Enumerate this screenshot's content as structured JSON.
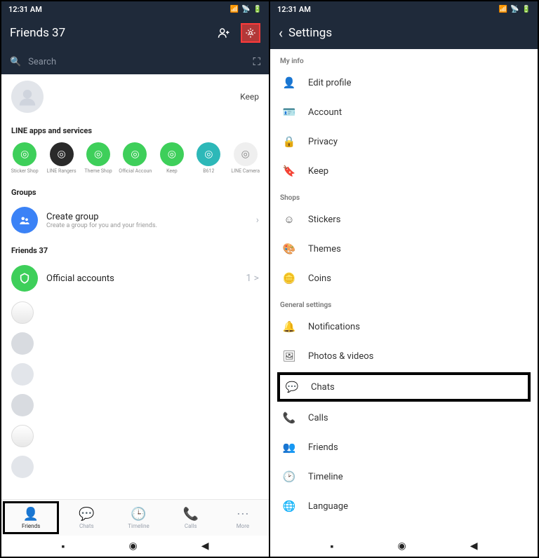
{
  "left": {
    "status": {
      "time": "12:31 AM"
    },
    "header": {
      "title": "Friends 37"
    },
    "search": {
      "placeholder": "Search"
    },
    "profile": {
      "keep": "Keep"
    },
    "sections": {
      "apps_header": "LINE apps and services",
      "groups_header": "Groups",
      "friends_header": "Friends 37"
    },
    "apps": [
      {
        "label": "Sticker Shop",
        "color": "bg-green"
      },
      {
        "label": "LINE Rangers",
        "color": "bg-dark"
      },
      {
        "label": "Theme Shop",
        "color": "bg-green"
      },
      {
        "label": "Official Accoun...",
        "color": "bg-green"
      },
      {
        "label": "Keep",
        "color": "bg-green"
      },
      {
        "label": "B612",
        "color": "bg-teal"
      },
      {
        "label": "LINE Camera",
        "color": "bg-white2"
      }
    ],
    "create_group": {
      "title": "Create group",
      "sub": "Create a group for you and your friends."
    },
    "official": {
      "title": "Official accounts",
      "count": "1 >"
    },
    "tabs": [
      {
        "label": "Friends"
      },
      {
        "label": "Chats"
      },
      {
        "label": "Timeline"
      },
      {
        "label": "Calls"
      },
      {
        "label": "More"
      }
    ]
  },
  "right": {
    "status": {
      "time": "12:31 AM"
    },
    "header": {
      "title": "Settings"
    },
    "sections": {
      "myinfo": "My info",
      "shops": "Shops",
      "general": "General settings"
    },
    "myinfo_items": [
      {
        "label": "Edit profile"
      },
      {
        "label": "Account"
      },
      {
        "label": "Privacy"
      },
      {
        "label": "Keep"
      }
    ],
    "shops_items": [
      {
        "label": "Stickers"
      },
      {
        "label": "Themes"
      },
      {
        "label": "Coins"
      }
    ],
    "general_items": [
      {
        "label": "Notifications"
      },
      {
        "label": "Photos & videos"
      },
      {
        "label": "Chats"
      },
      {
        "label": "Calls"
      },
      {
        "label": "Friends"
      },
      {
        "label": "Timeline"
      },
      {
        "label": "Language"
      }
    ]
  }
}
